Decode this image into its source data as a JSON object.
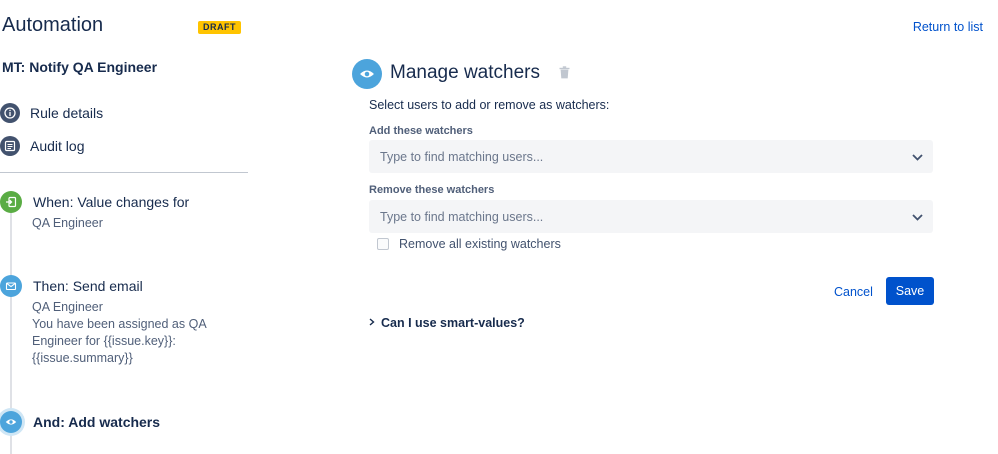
{
  "header": {
    "app_title": "Automation",
    "draft_badge": "DRAFT",
    "rule_name": "MT: Notify QA Engineer",
    "return_link": "Return to list"
  },
  "nav": {
    "items": [
      {
        "label": "Rule details",
        "icon": "info-icon"
      },
      {
        "label": "Audit log",
        "icon": "list-icon"
      }
    ]
  },
  "steps": [
    {
      "title": "When: Value changes for",
      "lines": [
        "QA Engineer"
      ],
      "icon": "trigger-icon",
      "color": "#5aac44"
    },
    {
      "title": "Then: Send email",
      "lines": [
        "QA Engineer",
        "You have been assigned as QA",
        "Engineer for {{issue.key}}:",
        "{{issue.summary}}"
      ],
      "icon": "mail-icon",
      "color": "#4ca4dc"
    },
    {
      "title": "And: Add watchers",
      "lines": [],
      "icon": "eye-icon",
      "color": "#4ca4dc"
    }
  ],
  "action": {
    "title": "Manage watchers",
    "icon": "eye-icon",
    "instructions": "Select users to add or remove as watchers:",
    "add_label": "Add these watchers",
    "add_placeholder": "Type to find matching users...",
    "remove_label": "Remove these watchers",
    "remove_placeholder": "Type to find matching users...",
    "remove_all_label": "Remove all existing watchers",
    "remove_all_checked": false,
    "cancel_label": "Cancel",
    "save_label": "Save",
    "smart_values_label": "Can I use smart-values?"
  },
  "colors": {
    "accent": "#0052cc",
    "draft": "#ffc400",
    "nav_icon": "#42526e",
    "trigger": "#5aac44",
    "action": "#4ca4dc"
  }
}
